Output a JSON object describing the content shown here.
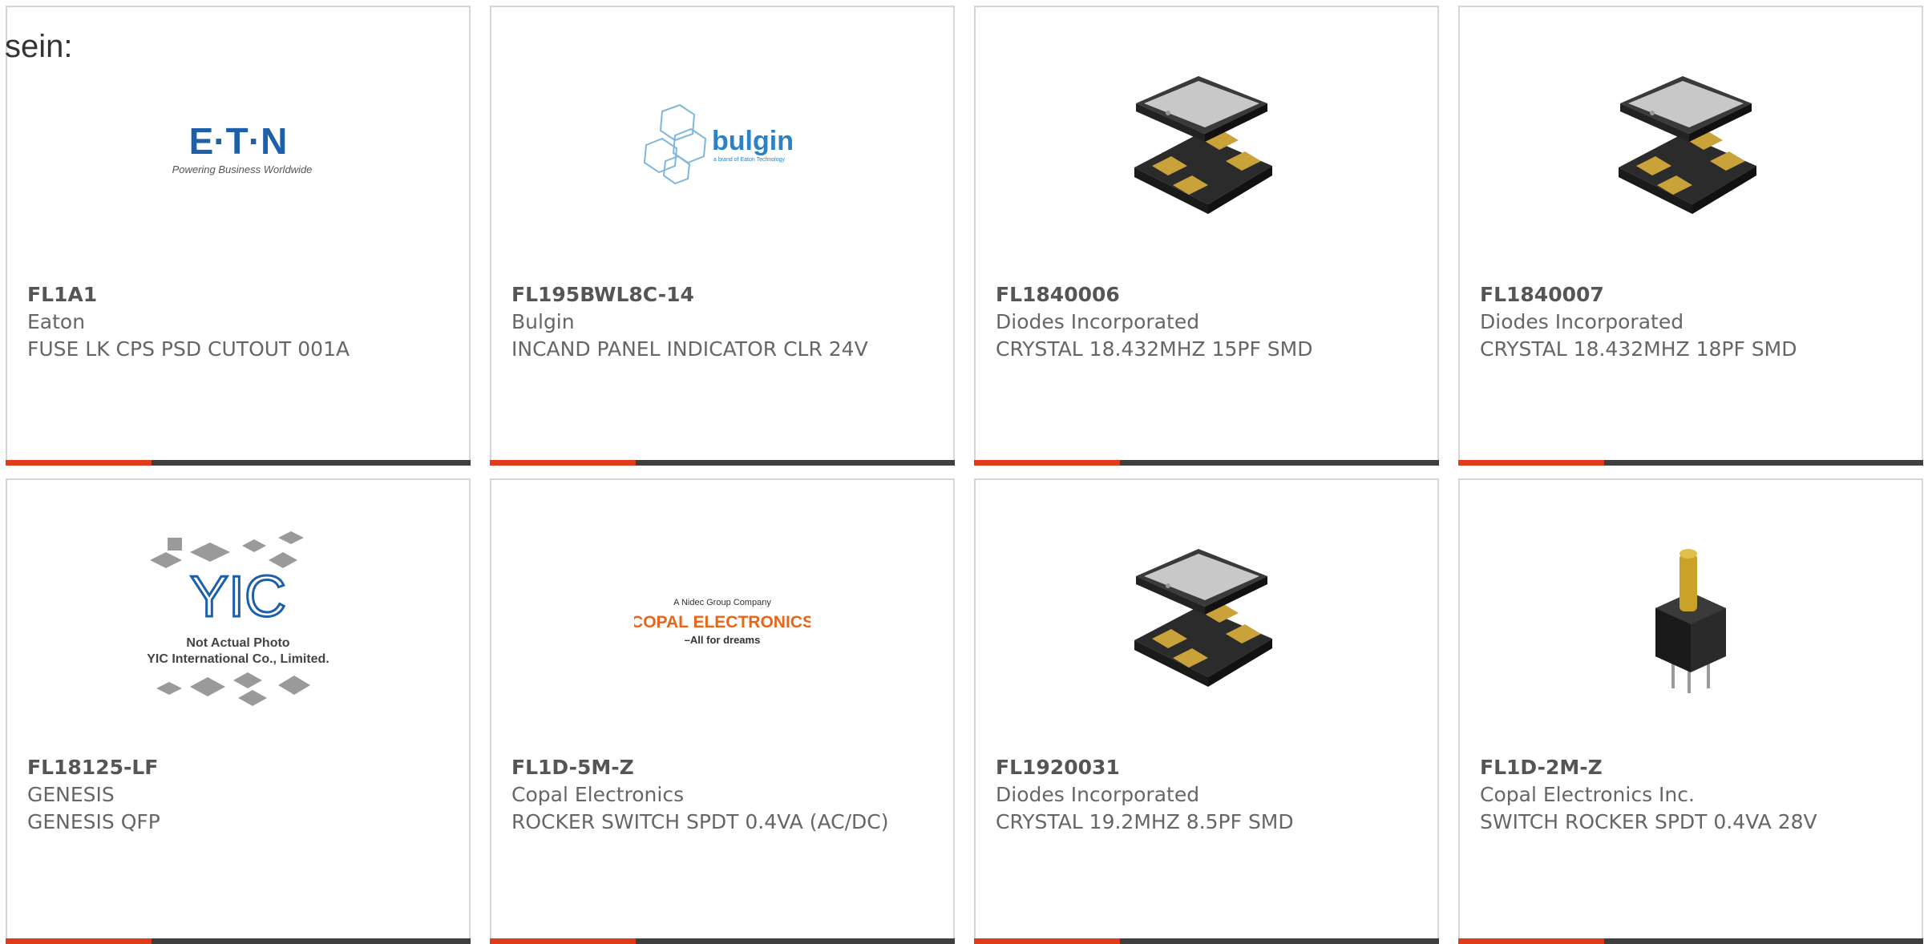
{
  "intro_text": "sein:",
  "colors": {
    "accent": "#e03c1c",
    "bar": "#3f3f3f",
    "border": "#d6d6d6",
    "text": "#555555"
  },
  "products": [
    {
      "part_number": "FL1A1",
      "manufacturer": "Eaton",
      "description": "FUSE LK CPS PSD CUTOUT 001A",
      "image": "eaton-logo",
      "logo_text": "E·T·N",
      "logo_tagline": "Powering Business Worldwide"
    },
    {
      "part_number": "FL195BWL8C-14",
      "manufacturer": "Bulgin",
      "description": "INCAND PANEL INDICATOR CLR 24V",
      "image": "bulgin-logo",
      "logo_text": "bulgin",
      "logo_tagline": "a brand of Eaton Technology"
    },
    {
      "part_number": "FL1840006",
      "manufacturer": "Diodes Incorporated",
      "description": "CRYSTAL 18.432MHZ 15PF SMD",
      "image": "smd-crystal-photo"
    },
    {
      "part_number": "FL1840007",
      "manufacturer": "Diodes Incorporated",
      "description": "CRYSTAL 18.432MHZ 18PF SMD",
      "image": "smd-crystal-photo"
    },
    {
      "part_number": "FL18125-LF",
      "manufacturer": "GENESIS",
      "description": "GENESIS QFP",
      "image": "yic-placeholder",
      "logo_text": "YIC",
      "caption_line1": "Not Actual Photo",
      "caption_line2": "YIC International Co., Limited."
    },
    {
      "part_number": "FL1D-5M-Z",
      "manufacturer": "Copal Electronics",
      "description": "ROCKER SWITCH SPDT 0.4VA (AC/DC)",
      "image": "copal-logo",
      "logo_top": "A Nidec Group Company",
      "logo_text": "COPAL ELECTRONICS",
      "logo_tagline": "–All for dreams"
    },
    {
      "part_number": "FL1920031",
      "manufacturer": "Diodes Incorporated",
      "description": "CRYSTAL 19.2MHZ 8.5PF SMD",
      "image": "smd-crystal-photo"
    },
    {
      "part_number": "FL1D-2M-Z",
      "manufacturer": "Copal Electronics Inc.",
      "description": "SWITCH ROCKER SPDT 0.4VA 28V",
      "image": "rocker-switch-photo"
    }
  ]
}
